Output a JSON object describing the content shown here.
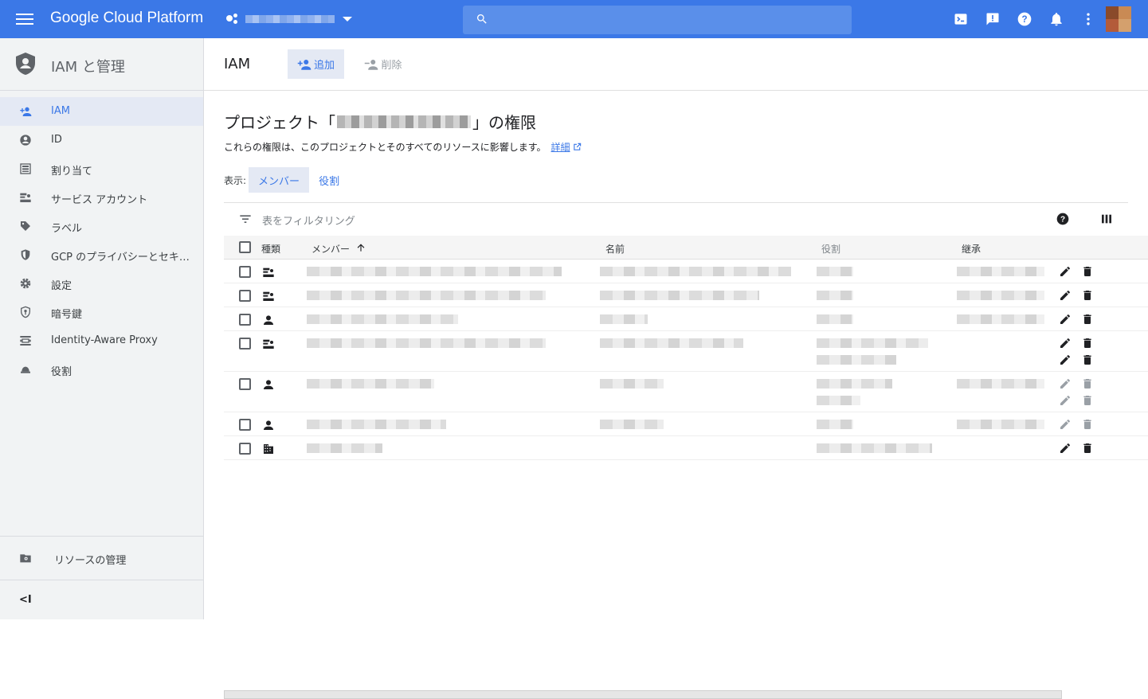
{
  "topbar": {
    "brand": "Google Cloud Platform",
    "search_placeholder": "",
    "icons": [
      "menu-icon",
      "project-icon",
      "search-icon",
      "cloud-shell-icon",
      "feedback-icon",
      "help-icon",
      "notifications-icon",
      "more-icon",
      "avatar"
    ]
  },
  "sidebar": {
    "title": "IAM と管理",
    "items": [
      {
        "label": "IAM",
        "icon": "person-add-icon",
        "active": true
      },
      {
        "label": "ID",
        "icon": "account-circle-icon"
      },
      {
        "label": "割り当て",
        "icon": "quota-icon"
      },
      {
        "label": "サービス アカウント",
        "icon": "service-account-icon"
      },
      {
        "label": "ラベル",
        "icon": "label-icon"
      },
      {
        "label": "GCP のプライバシーとセキ…",
        "icon": "shield-icon"
      },
      {
        "label": "設定",
        "icon": "settings-icon"
      },
      {
        "label": "暗号鍵",
        "icon": "key-shield-icon"
      },
      {
        "label": "Identity-Aware Proxy",
        "icon": "iap-icon"
      },
      {
        "label": "役割",
        "icon": "roles-icon"
      }
    ],
    "manage_resources": "リソースの管理",
    "collapse": "<I"
  },
  "main": {
    "header_title": "IAM",
    "add_label": "追加",
    "delete_label": "削除",
    "page_title_prefix": "プロジェクト「",
    "page_title_suffix": "」の権限",
    "subtitle": "これらの権限は、このプロジェクトとそのすべてのリソースに影響します。",
    "details_link": "詳細",
    "view_label": "表示:",
    "view_tabs": [
      {
        "label": "メンバー",
        "selected": true
      },
      {
        "label": "役割",
        "selected": false
      }
    ],
    "filter_placeholder": "表をフィルタリング",
    "columns": {
      "type": "種類",
      "member": "メンバー",
      "name": "名前",
      "role": "役割",
      "inherit": "継承"
    }
  },
  "rows": [
    {
      "type": "service-account-icon"
    },
    {
      "type": "service-account-icon"
    },
    {
      "type": "person-icon"
    },
    {
      "type": "service-account-icon"
    },
    {
      "type": "person-icon"
    },
    {
      "type": "person-icon"
    },
    {
      "type": "domain-icon"
    }
  ],
  "colors": {
    "accent": "#3b78e7",
    "topbar": "#3b78e7",
    "sidebar_bg": "#f1f3f4",
    "selected_bg": "#e4e9f4"
  }
}
